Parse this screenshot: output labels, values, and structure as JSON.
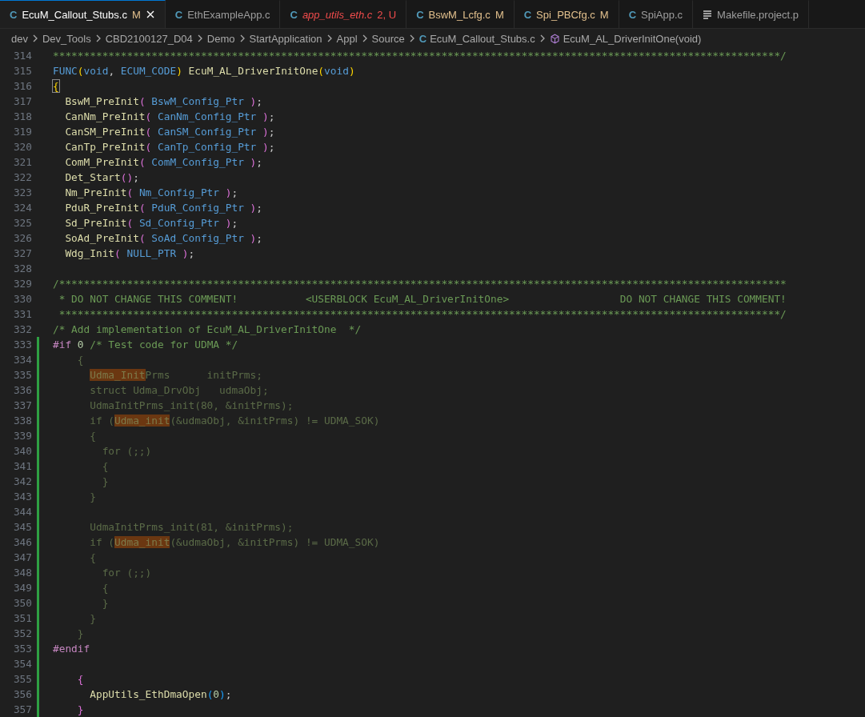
{
  "tabs": [
    {
      "label": "EcuM_Callout_Stubs.c",
      "badge": "M",
      "error": false,
      "selected": true,
      "icon": {
        "kind": "letter",
        "text": "C"
      }
    },
    {
      "label": "EthExampleApp.c",
      "error": false,
      "selected": false,
      "icon": {
        "kind": "letter",
        "text": "C"
      }
    },
    {
      "label": "app_utils_eth.c",
      "badge": "2, U",
      "error": true,
      "selected": false,
      "icon": {
        "kind": "letter",
        "text": "C"
      }
    },
    {
      "label": "BswM_Lcfg.c",
      "badge": "M",
      "error": false,
      "selected": false,
      "icon": {
        "kind": "letter",
        "text": "C"
      }
    },
    {
      "label": "Spi_PBCfg.c",
      "badge": "M",
      "error": false,
      "selected": false,
      "icon": {
        "kind": "letter",
        "text": "C"
      }
    },
    {
      "label": "SpiApp.c",
      "error": false,
      "selected": false,
      "icon": {
        "kind": "letter",
        "text": "C"
      }
    },
    {
      "label": "Makefile.project.p",
      "error": false,
      "selected": false,
      "icon": {
        "kind": "lines"
      }
    }
  ],
  "breadcrumbs": [
    {
      "label": "dev"
    },
    {
      "label": "Dev_Tools"
    },
    {
      "label": "CBD2100127_D04"
    },
    {
      "label": "Demo"
    },
    {
      "label": "StartApplication"
    },
    {
      "label": "Appl"
    },
    {
      "label": "Source"
    },
    {
      "label": "EcuM_Callout_Stubs.c",
      "icon": {
        "kind": "letter",
        "text": "C"
      }
    },
    {
      "label": "EcuM_AL_DriverInitOne(void)",
      "icon": {
        "kind": "cube"
      }
    }
  ],
  "lines": [
    {
      "number": "314",
      "modified": false,
      "tokens": [
        {
          "kind": "comment",
          "text": "**********************************************************************************************************************/"
        }
      ]
    },
    {
      "number": "315",
      "modified": false,
      "tokens": [
        {
          "kind": "keyword",
          "text": "FUNC"
        },
        {
          "kind": "p1",
          "text": "("
        },
        {
          "kind": "keyword",
          "text": "void"
        },
        {
          "kind": "text",
          "text": ", "
        },
        {
          "kind": "keyword",
          "text": "ECUM_CODE"
        },
        {
          "kind": "p1",
          "text": ")"
        },
        {
          "kind": "func",
          "text": " EcuM_AL_DriverInitOne"
        },
        {
          "kind": "p1",
          "text": "("
        },
        {
          "kind": "keyword",
          "text": "void"
        },
        {
          "kind": "p1",
          "text": ")"
        }
      ]
    },
    {
      "number": "316",
      "modified": false,
      "tokens": [
        {
          "kind": "brace-match",
          "text": "{"
        }
      ]
    },
    {
      "number": "317",
      "modified": false,
      "tokens": [
        {
          "kind": "func",
          "text": "  BswM_PreInit"
        },
        {
          "kind": "p2",
          "text": "("
        },
        {
          "kind": "keyword",
          "text": " BswM_Config_Ptr "
        },
        {
          "kind": "p2",
          "text": ")"
        },
        {
          "kind": "text",
          "text": ";"
        }
      ]
    },
    {
      "number": "318",
      "modified": false,
      "tokens": [
        {
          "kind": "func",
          "text": "  CanNm_PreInit"
        },
        {
          "kind": "p2",
          "text": "("
        },
        {
          "kind": "keyword",
          "text": " CanNm_Config_Ptr "
        },
        {
          "kind": "p2",
          "text": ")"
        },
        {
          "kind": "text",
          "text": ";"
        }
      ]
    },
    {
      "number": "319",
      "modified": false,
      "tokens": [
        {
          "kind": "func",
          "text": "  CanSM_PreInit"
        },
        {
          "kind": "p2",
          "text": "("
        },
        {
          "kind": "keyword",
          "text": " CanSM_Config_Ptr "
        },
        {
          "kind": "p2",
          "text": ")"
        },
        {
          "kind": "text",
          "text": ";"
        }
      ]
    },
    {
      "number": "320",
      "modified": false,
      "tokens": [
        {
          "kind": "func",
          "text": "  CanTp_PreInit"
        },
        {
          "kind": "p2",
          "text": "("
        },
        {
          "kind": "keyword",
          "text": " CanTp_Config_Ptr "
        },
        {
          "kind": "p2",
          "text": ")"
        },
        {
          "kind": "text",
          "text": ";"
        }
      ]
    },
    {
      "number": "321",
      "modified": false,
      "tokens": [
        {
          "kind": "func",
          "text": "  ComM_PreInit"
        },
        {
          "kind": "p2",
          "text": "("
        },
        {
          "kind": "keyword",
          "text": " ComM_Config_Ptr "
        },
        {
          "kind": "p2",
          "text": ")"
        },
        {
          "kind": "text",
          "text": ";"
        }
      ]
    },
    {
      "number": "322",
      "modified": false,
      "tokens": [
        {
          "kind": "func",
          "text": "  Det_Start"
        },
        {
          "kind": "p2",
          "text": "()"
        },
        {
          "kind": "text",
          "text": ";"
        }
      ]
    },
    {
      "number": "323",
      "modified": false,
      "tokens": [
        {
          "kind": "func",
          "text": "  Nm_PreInit"
        },
        {
          "kind": "p2",
          "text": "("
        },
        {
          "kind": "keyword",
          "text": " Nm_Config_Ptr "
        },
        {
          "kind": "p2",
          "text": ")"
        },
        {
          "kind": "text",
          "text": ";"
        }
      ]
    },
    {
      "number": "324",
      "modified": false,
      "tokens": [
        {
          "kind": "func",
          "text": "  PduR_PreInit"
        },
        {
          "kind": "p2",
          "text": "("
        },
        {
          "kind": "keyword",
          "text": " PduR_Config_Ptr "
        },
        {
          "kind": "p2",
          "text": ")"
        },
        {
          "kind": "text",
          "text": ";"
        }
      ]
    },
    {
      "number": "325",
      "modified": false,
      "tokens": [
        {
          "kind": "func",
          "text": "  Sd_PreInit"
        },
        {
          "kind": "p2",
          "text": "("
        },
        {
          "kind": "keyword",
          "text": " Sd_Config_Ptr "
        },
        {
          "kind": "p2",
          "text": ")"
        },
        {
          "kind": "text",
          "text": ";"
        }
      ]
    },
    {
      "number": "326",
      "modified": false,
      "tokens": [
        {
          "kind": "func",
          "text": "  SoAd_PreInit"
        },
        {
          "kind": "p2",
          "text": "("
        },
        {
          "kind": "keyword",
          "text": " SoAd_Config_Ptr "
        },
        {
          "kind": "p2",
          "text": ")"
        },
        {
          "kind": "text",
          "text": ";"
        }
      ]
    },
    {
      "number": "327",
      "modified": false,
      "tokens": [
        {
          "kind": "func",
          "text": "  Wdg_Init"
        },
        {
          "kind": "p2",
          "text": "("
        },
        {
          "kind": "keyword",
          "text": " NULL_PTR "
        },
        {
          "kind": "p2",
          "text": ")"
        },
        {
          "kind": "text",
          "text": ";"
        }
      ]
    },
    {
      "number": "328",
      "modified": false
    },
    {
      "number": "329",
      "modified": false,
      "tokens": [
        {
          "kind": "comment",
          "text": "/**********************************************************************************************************************"
        }
      ]
    },
    {
      "number": "330",
      "modified": false,
      "tokens": [
        {
          "kind": "comment",
          "text": " * DO NOT CHANGE THIS COMMENT!           <USERBLOCK EcuM_AL_DriverInitOne>                  DO NOT CHANGE THIS COMMENT!"
        }
      ]
    },
    {
      "number": "331",
      "modified": false,
      "tokens": [
        {
          "kind": "comment",
          "text": " *********************************************************************************************************************/"
        }
      ]
    },
    {
      "number": "332",
      "modified": false,
      "tokens": [
        {
          "kind": "comment",
          "text": "/* Add implementation of EcuM_AL_DriverInitOne  */"
        }
      ]
    },
    {
      "number": "333",
      "modified": true,
      "tokens": [
        {
          "kind": "preproc",
          "text": "#if "
        },
        {
          "kind": "number",
          "text": "0"
        },
        {
          "kind": "comment",
          "text": " /* Test code for UDMA */"
        }
      ]
    },
    {
      "number": "334",
      "modified": true,
      "tokens": [
        {
          "kind": "inactive",
          "text": "    {"
        }
      ]
    },
    {
      "number": "335",
      "modified": true,
      "tokens": [
        {
          "kind": "match",
          "text": "      Udma_Init"
        },
        {
          "kind": "inactive",
          "text": "Prms      initPrms;"
        }
      ]
    },
    {
      "number": "336",
      "modified": true,
      "tokens": [
        {
          "kind": "inactive",
          "text": "      struct Udma_DrvObj   udmaObj;"
        }
      ]
    },
    {
      "number": "337",
      "modified": true,
      "tokens": [
        {
          "kind": "inactive",
          "text": "      UdmaInitPrms_init(80, &initPrms);"
        }
      ]
    },
    {
      "number": "338",
      "modified": true,
      "tokens": [
        {
          "kind": "inactive",
          "text": "      if ("
        },
        {
          "kind": "match",
          "text": "Udma_init"
        },
        {
          "kind": "inactive",
          "text": "(&udmaObj, &initPrms) != UDMA_SOK)"
        }
      ]
    },
    {
      "number": "339",
      "modified": true,
      "tokens": [
        {
          "kind": "inactive",
          "text": "      {"
        }
      ]
    },
    {
      "number": "340",
      "modified": true,
      "tokens": [
        {
          "kind": "inactive",
          "text": "        for (;;)"
        }
      ]
    },
    {
      "number": "341",
      "modified": true,
      "tokens": [
        {
          "kind": "inactive",
          "text": "        {"
        }
      ]
    },
    {
      "number": "342",
      "modified": true,
      "tokens": [
        {
          "kind": "inactive",
          "text": "        }"
        }
      ]
    },
    {
      "number": "343",
      "modified": true,
      "tokens": [
        {
          "kind": "inactive",
          "text": "      }"
        }
      ]
    },
    {
      "number": "344",
      "modified": true
    },
    {
      "number": "345",
      "modified": true,
      "tokens": [
        {
          "kind": "inactive",
          "text": "      UdmaInitPrms_init(81, &initPrms);"
        }
      ]
    },
    {
      "number": "346",
      "modified": true,
      "tokens": [
        {
          "kind": "inactive",
          "text": "      if ("
        },
        {
          "kind": "match",
          "text": "Udma_init"
        },
        {
          "kind": "inactive",
          "text": "(&udmaObj, &initPrms) != UDMA_SOK)"
        }
      ]
    },
    {
      "number": "347",
      "modified": true,
      "tokens": [
        {
          "kind": "inactive",
          "text": "      {"
        }
      ]
    },
    {
      "number": "348",
      "modified": true,
      "tokens": [
        {
          "kind": "inactive",
          "text": "        for (;;)"
        }
      ]
    },
    {
      "number": "349",
      "modified": true,
      "tokens": [
        {
          "kind": "inactive",
          "text": "        {"
        }
      ]
    },
    {
      "number": "350",
      "modified": true,
      "tokens": [
        {
          "kind": "inactive",
          "text": "        }"
        }
      ]
    },
    {
      "number": "351",
      "modified": true,
      "tokens": [
        {
          "kind": "inactive",
          "text": "      }"
        }
      ]
    },
    {
      "number": "352",
      "modified": true,
      "tokens": [
        {
          "kind": "inactive",
          "text": "    }"
        }
      ]
    },
    {
      "number": "353",
      "modified": true,
      "tokens": [
        {
          "kind": "preproc",
          "text": "#endif"
        }
      ]
    },
    {
      "number": "354",
      "modified": true
    },
    {
      "number": "355",
      "modified": true,
      "tokens": [
        {
          "kind": "p2",
          "text": "    {"
        }
      ]
    },
    {
      "number": "356",
      "modified": true,
      "tokens": [
        {
          "kind": "func",
          "text": "      AppUtils_EthDmaOpen"
        },
        {
          "kind": "p3",
          "text": "("
        },
        {
          "kind": "number",
          "text": "0"
        },
        {
          "kind": "p3",
          "text": ")"
        },
        {
          "kind": "text",
          "text": ";"
        }
      ]
    },
    {
      "number": "357",
      "modified": true,
      "tokens": [
        {
          "kind": "p2",
          "text": "    }"
        }
      ]
    }
  ]
}
